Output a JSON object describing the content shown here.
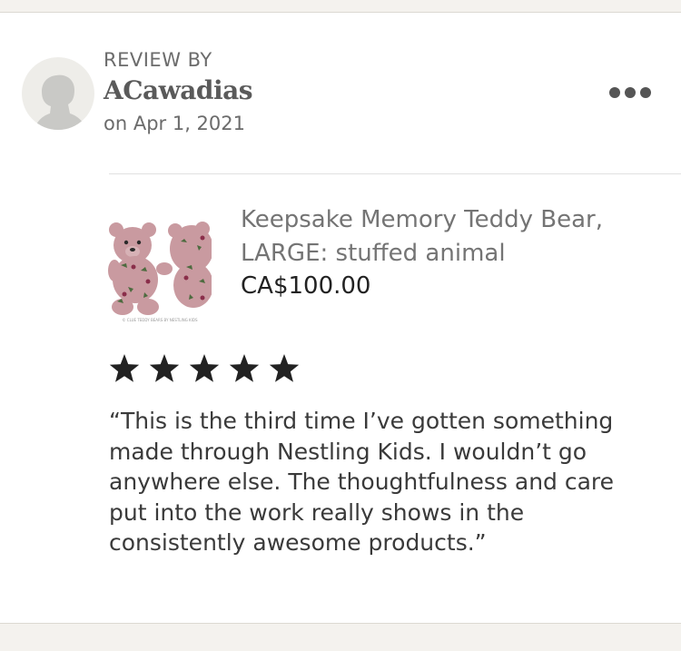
{
  "review": {
    "heading": "REVIEW BY",
    "reviewer_name": "ACawadias",
    "date": "on Apr 1, 2021",
    "more_icon": "more-dots-icon",
    "rating": 5,
    "rating_max": 5,
    "text": "“This is the third time I’ve gotten something made through Nestling Kids. I wouldn’t go anywhere else. The thoughtfulness and care put into the work really shows in the consistently awesome products.”"
  },
  "product": {
    "title": "Keepsake Memory Teddy Bear, LARGE: stuffed animal",
    "price": "CA$100.00",
    "image_caption": "© CLUE TEDDY BEARS BY NESTLING KIDS"
  },
  "colors": {
    "star": "#222222",
    "product_fabric": "#c99aa0",
    "avatar_bg": "#eeede9",
    "avatar_figure": "#c9c9c6"
  }
}
